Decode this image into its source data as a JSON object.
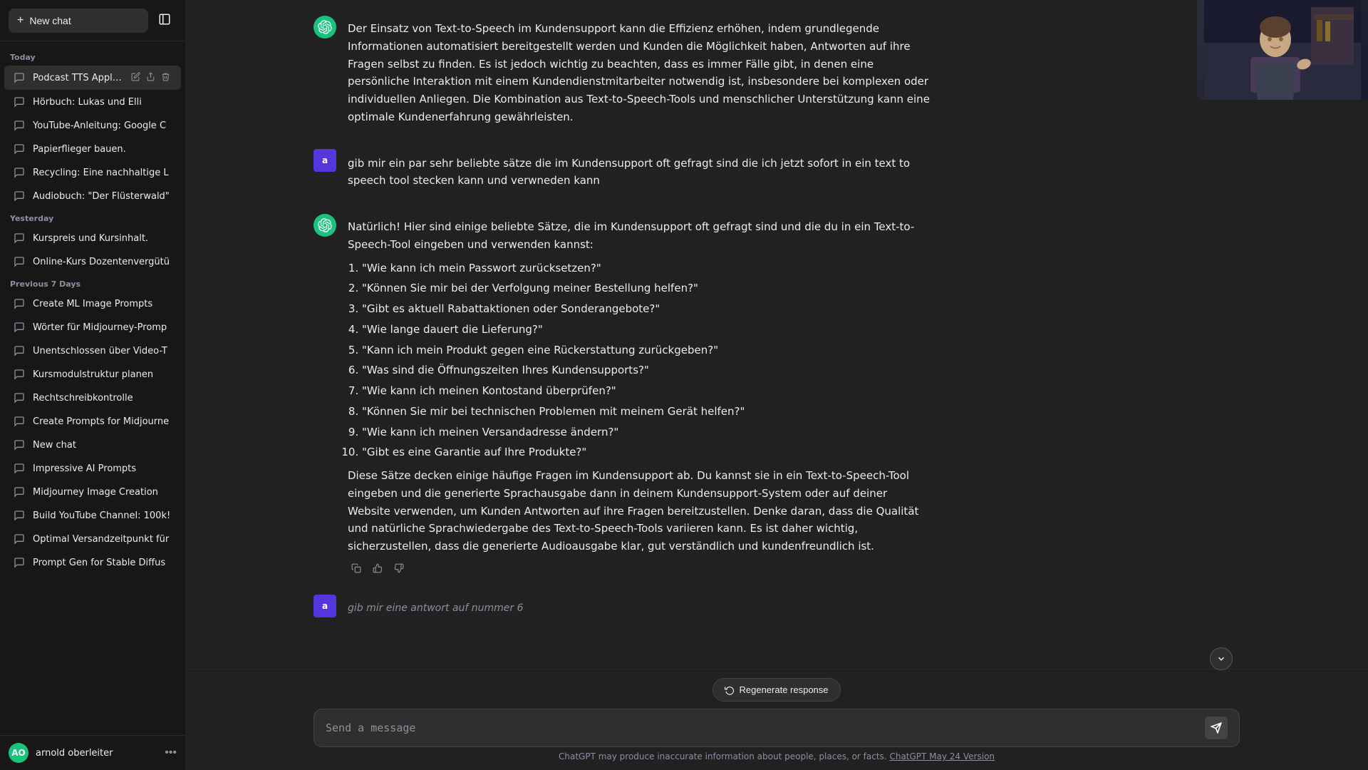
{
  "sidebar": {
    "new_chat_label": "New chat",
    "today_label": "Today",
    "yesterday_label": "Yesterday",
    "previous7_label": "Previous 7 Days",
    "today_items": [
      {
        "id": "t1",
        "label": "Podcast TTS Applica",
        "active": true
      },
      {
        "id": "t2",
        "label": "Hörbuch: Lukas und Elli"
      },
      {
        "id": "t3",
        "label": "YouTube-Anleitung: Google C"
      },
      {
        "id": "t4",
        "label": "Papierflieger bauen."
      },
      {
        "id": "t5",
        "label": "Recycling: Eine nachhaltige L"
      },
      {
        "id": "t6",
        "label": "Audiobuch: \"Der Flüsterwald\""
      }
    ],
    "yesterday_items": [
      {
        "id": "y1",
        "label": "Kurspreis und Kursinhalt."
      },
      {
        "id": "y2",
        "label": "Online-Kurs Dozentenvergütü"
      }
    ],
    "previous7_items": [
      {
        "id": "p1",
        "label": "Create ML Image Prompts"
      },
      {
        "id": "p2",
        "label": "Wörter für Midjourney-Promp"
      },
      {
        "id": "p3",
        "label": "Unentschlossen über Video-T"
      },
      {
        "id": "p4",
        "label": "Kursmodulstruktur planen"
      },
      {
        "id": "p5",
        "label": "Rechtschreibkontrolle"
      },
      {
        "id": "p6",
        "label": "Create Prompts for Midjourne"
      },
      {
        "id": "p7",
        "label": "New chat"
      },
      {
        "id": "p8",
        "label": "Impressive AI Prompts"
      },
      {
        "id": "p9",
        "label": "Midjourney Image Creation"
      },
      {
        "id": "p10",
        "label": "Build YouTube Channel: 100k!"
      },
      {
        "id": "p11",
        "label": "Optimal Versandzeitpunkt für"
      },
      {
        "id": "p12",
        "label": "Prompt Gen for Stable Diffus"
      }
    ],
    "user_name": "arnold oberleiter",
    "user_initials": "AO"
  },
  "chat": {
    "top_message_partial": "Der Einsatz von Text-to-Speech im Kundensupport kann die Effizienz erhöhen, indem grundlegende Informationen automatisiert bereitgestellt werden und Kunden die Möglichkeit haben, Antworten auf ihre Fragen selbst zu finden. Es ist jedoch wichtig zu beachten, dass es immer Fälle gibt, in denen eine persönliche Interaktion mit einem Kundendienstmitarbeiter notwendig ist, insbesondere bei komplexen oder individuellen Anliegen. Die Kombination aus Text-to-Speech-Tools und menschlicher Unterstützung kann eine optimale Kundenerfahrung gewährleisten.",
    "user_message_1": "gib mir ein par sehr beliebte sätze die im Kundensupport oft gefragt sind die ich jetzt sofort in ein text to speech tool stecken kann und verwneden kann",
    "assistant_intro": "Natürlich! Hier sind einige beliebte Sätze, die im Kundensupport oft gefragt sind und die du in ein Text-to-Speech-Tool eingeben und verwenden kannst:",
    "list_items": [
      "\"Wie kann ich mein Passwort zurücksetzen?\"",
      "\"Können Sie mir bei der Verfolgung meiner Bestellung helfen?\"",
      "\"Gibt es aktuell Rabattaktionen oder Sonderangebote?\"",
      "\"Wie lange dauert die Lieferung?\"",
      "\"Kann ich mein Produkt gegen eine Rückerstattung zurückgeben?\"",
      "\"Was sind die Öffnungszeiten Ihres Kundensupports?\"",
      "\"Wie kann ich meinen Kontostand überprüfen?\"",
      "\"Können Sie mir bei technischen Problemen mit meinem Gerät helfen?\"",
      "\"Wie kann ich meinen Versandadresse ändern?\"",
      "\"Gibt es eine Garantie auf Ihre Produkte?\""
    ],
    "assistant_outro": "Diese Sätze decken einige häufige Fragen im Kundensupport ab. Du kannst sie in ein Text-to-Speech-Tool eingeben und die generierte Sprachausgabe dann in deinem Kundensupport-System oder auf deiner Website verwenden, um Kunden Antworten auf ihre Fragen bereitzustellen. Denke daran, dass die Qualität und natürliche Sprachwiedergabe des Text-to-Speech-Tools variieren kann. Es ist daher wichtig, sicherzustellen, dass die generierte Audioausgabe klar, gut verständlich und kundenfreundlich ist.",
    "user_message_2": "gib mir eine antwort auf nummer 6",
    "regenerate_label": "Regenerate response",
    "input_placeholder": "Send a message",
    "send_label": "Send",
    "disclaimer_text": "ChatGPT may produce inaccurate information about people, places, or facts.",
    "disclaimer_link": "ChatGPT May 24 Version",
    "user_avatar_letter": "a",
    "gpt_color": "#19c37d"
  },
  "icons": {
    "plus": "+",
    "sidebar_toggle": "⊞",
    "chat_bubble": "💬",
    "pencil": "✎",
    "export": "↑",
    "trash": "🗑",
    "copy": "⧉",
    "thumbs_up": "👍",
    "thumbs_down": "👎",
    "regenerate": "↺",
    "send_arrow": "▶",
    "scroll_down": "↓",
    "more": "•••"
  }
}
